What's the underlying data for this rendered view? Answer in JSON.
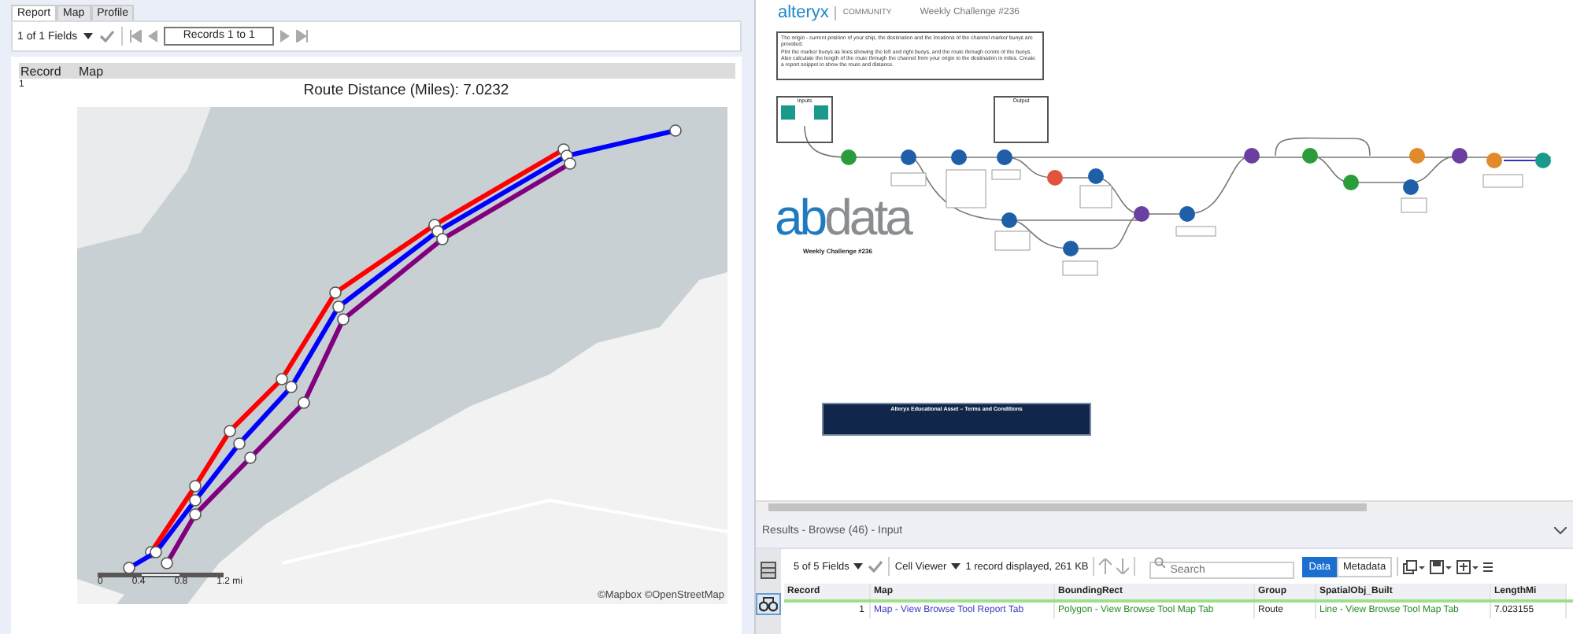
{
  "report_pane": {
    "tabs": [
      {
        "label": "Report",
        "selected": true
      },
      {
        "label": "Map",
        "selected": false
      },
      {
        "label": "Profile",
        "selected": false
      }
    ],
    "toolbar": {
      "fields": "1 of 1 Fields",
      "records": "Records 1 to 1"
    },
    "columns": [
      "Record",
      "Map"
    ],
    "record": "1",
    "map_title": "Route Distance (Miles): 7.0232",
    "map": {
      "routes": [
        {
          "kind": "left",
          "color": "#ff0000"
        },
        {
          "kind": "centre",
          "color": "#0000ff"
        },
        {
          "kind": "right",
          "color": "#800080"
        }
      ],
      "scale_labels": [
        "0",
        "0.4",
        "0.8",
        "1.2 mi"
      ],
      "attribution": "©Mapbox ©OpenStreetMap"
    }
  },
  "workflow": {
    "brand": "alteryx",
    "community": "COMMUNITY",
    "title": "Weekly Challenge #236",
    "description": [
      "The origin - current position of your ship, the destination and the locations of the channel marker buoys are provided.",
      "Plot the marker buoys as lines showing the left and right buoys, and the route through centre of the buoys. Also calculate the length of the route through the channel from your origin to the destination in miles. Create a report snippet to show the route and distance."
    ],
    "containers": [
      "Inputs",
      "Output"
    ],
    "logo": {
      "accent": "ab",
      "rest": "data",
      "caption": "Weekly Challenge #236"
    },
    "dialog_title": "Alteryx Educational Asset – Terms and Conditions"
  },
  "results": {
    "title": "Results - Browse (46) - Input",
    "fields": "5 of 5 Fields",
    "viewer": "Cell Viewer",
    "summary": "1 record displayed, 261 KB",
    "search": {
      "placeholder": "Search"
    },
    "views": [
      {
        "label": "Data",
        "selected": true
      },
      {
        "label": "Metadata",
        "selected": false
      }
    ],
    "columns": [
      "Record",
      "Map",
      "BoundingRect",
      "Group",
      "SpatialObj_Built",
      "LengthMi"
    ],
    "rows": [
      [
        "1",
        "Map - View Browse Tool Report Tab",
        "Polygon - View Browse Tool Map Tab",
        "Route",
        "Line - View Browse Tool Map Tab",
        "7.023155"
      ]
    ]
  }
}
